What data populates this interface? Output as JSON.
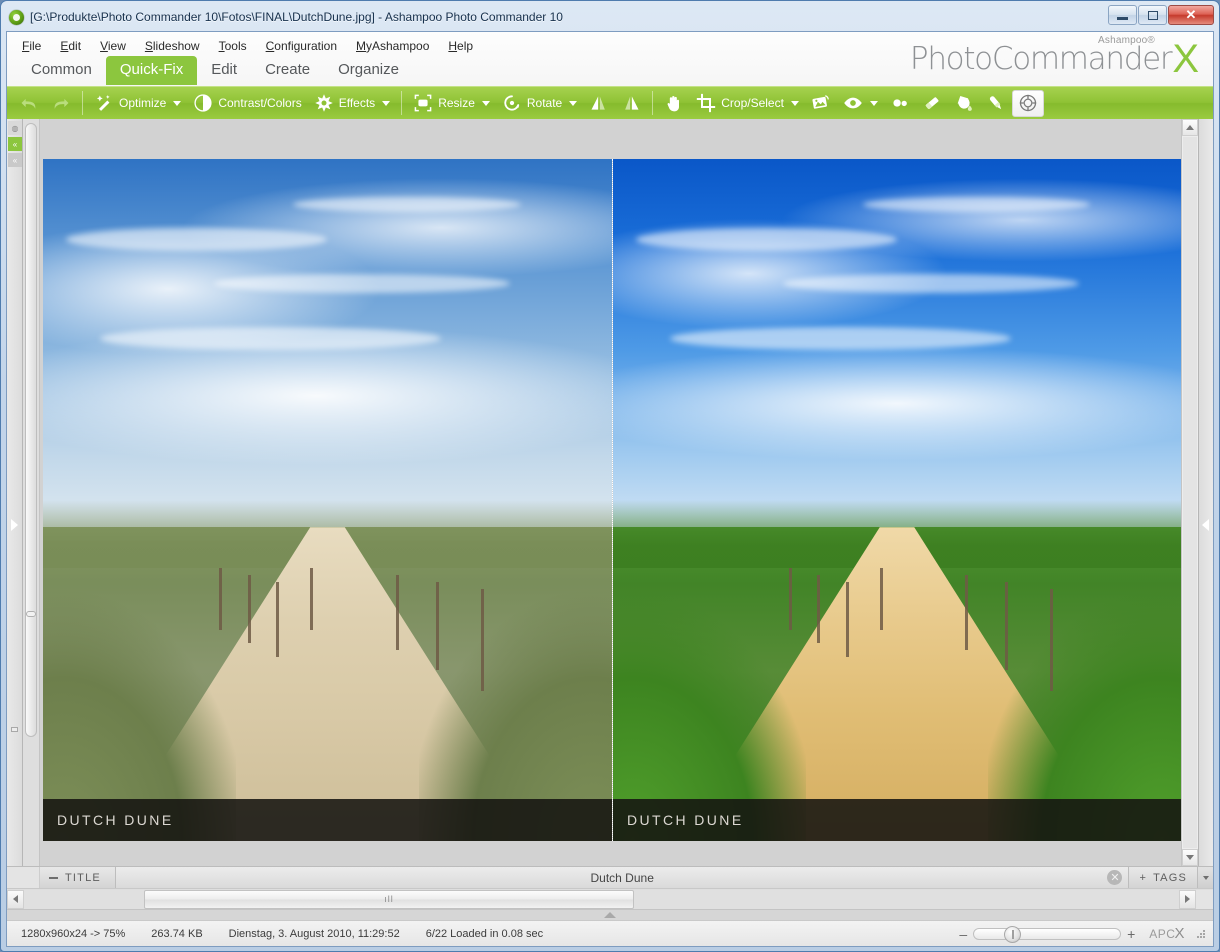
{
  "window": {
    "title": "[G:\\Produkte\\Photo Commander 10\\Fotos\\FINAL\\DutchDune.jpg] - Ashampoo Photo Commander 10",
    "app_icon": "ashampoo-logo-icon",
    "controls": {
      "minimize": "minimize-icon",
      "maximize": "maximize-icon",
      "close": "✕"
    }
  },
  "menu": {
    "items": [
      {
        "acc": "F",
        "rest": "ile"
      },
      {
        "acc": "E",
        "rest": "dit"
      },
      {
        "acc": "V",
        "rest": "iew"
      },
      {
        "acc": "S",
        "rest": "lideshow"
      },
      {
        "acc": "T",
        "rest": "ools"
      },
      {
        "acc": "C",
        "rest": "onfiguration"
      },
      {
        "acc": "M",
        "rest": "yAshampoo"
      },
      {
        "acc": "H",
        "rest": "elp"
      }
    ]
  },
  "logo": {
    "sup": "Ashampoo®",
    "main": "PhotoCommander",
    "x": "X",
    "accent": "#8cc63e"
  },
  "tabs": [
    {
      "label": "Common",
      "active": false
    },
    {
      "label": "Quick-Fix",
      "active": true
    },
    {
      "label": "Edit",
      "active": false
    },
    {
      "label": "Create",
      "active": false
    },
    {
      "label": "Organize",
      "active": false
    }
  ],
  "toolbar": {
    "background": "#8fc235",
    "items": [
      {
        "icon": "undo-icon",
        "label": ""
      },
      {
        "icon": "redo-icon",
        "label": ""
      },
      {
        "icon": "magic-wand-icon",
        "label": "Optimize",
        "dropdown": true
      },
      {
        "icon": "contrast-icon",
        "label": "Contrast/Colors",
        "dropdown": false
      },
      {
        "icon": "effects-starburst-icon",
        "label": "Effects",
        "dropdown": true
      },
      {
        "icon": "resize-icon",
        "label": "Resize",
        "dropdown": true
      },
      {
        "icon": "rotate-icon",
        "label": "Rotate",
        "dropdown": true
      },
      {
        "icon": "flip-horizontal-icon",
        "label": ""
      },
      {
        "icon": "flip-vertical-icon",
        "label": ""
      },
      {
        "icon": "hand-pan-icon",
        "label": ""
      },
      {
        "icon": "crop-icon",
        "label": "Crop/Select",
        "dropdown": true
      },
      {
        "icon": "straighten-image-icon",
        "label": ""
      },
      {
        "icon": "red-eye-icon",
        "label": "",
        "dropdown": true
      },
      {
        "icon": "blemish-removal-icon",
        "label": ""
      },
      {
        "icon": "eraser-icon",
        "label": ""
      },
      {
        "icon": "paint-bucket-icon",
        "label": ""
      },
      {
        "icon": "retouch-brush-icon",
        "label": ""
      },
      {
        "icon": "before-after-compare-icon",
        "label": "",
        "active": true
      }
    ]
  },
  "rails": {
    "left": {
      "buttons": [
        "panel-toggle-icon",
        "collapse-left-icon",
        "collapse-left-alt-icon"
      ],
      "expand": "expand-left-panel-icon"
    },
    "right": {
      "expand": "expand-right-panel-icon"
    }
  },
  "viewer": {
    "before": {
      "caption": "DUTCH DUNE"
    },
    "after": {
      "caption": "DUTCH DUNE"
    },
    "divider": "before-after-divider"
  },
  "meta_bar": {
    "title_button": "TITLE",
    "title_value": "Dutch Dune",
    "clear_icon": "✕",
    "tags_button": "TAGS",
    "tags_plus": "+"
  },
  "hscroll": {
    "grip": "ıll"
  },
  "status": {
    "dimensions": "1280x960x24 -> 75%",
    "filesize": "263.74 KB",
    "datetime": "Dienstag, 3. August 2010, 11:29:52",
    "index": "6/22  Loaded in 0.08 sec",
    "zoom_minus": "–",
    "zoom_plus": "+",
    "brand": "APC",
    "brand_x": "X"
  }
}
